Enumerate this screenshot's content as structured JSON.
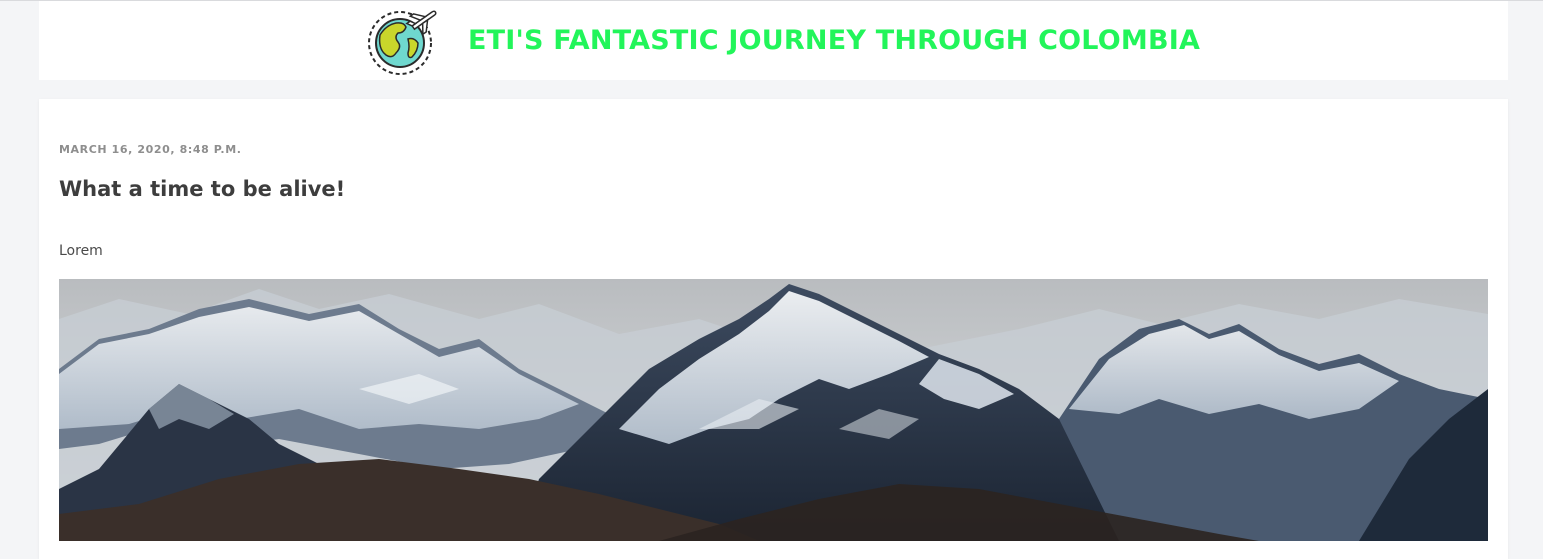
{
  "header": {
    "title": "ETI'S FANTASTIC JOURNEY THROUGH COLOMBIA",
    "logo_icon": "globe-airplane-icon"
  },
  "post": {
    "date": "MARCH 16, 2020, 8:48 P.M.",
    "title": "What a time to be alive!",
    "body": "Lorem",
    "image_subject": "snow-capped-mountains-photo"
  },
  "colors": {
    "title_green": "#22f55a",
    "background": "#f4f5f7",
    "card": "#ffffff"
  }
}
